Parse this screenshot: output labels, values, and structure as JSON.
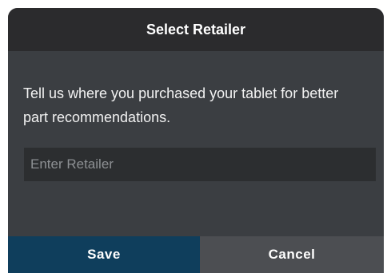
{
  "dialog": {
    "title": "Select Retailer",
    "message": "Tell us where you purchased your tablet for better part recommendations.",
    "retailer_input": {
      "value": "",
      "placeholder": "Enter Retailer"
    },
    "buttons": {
      "save_label": "Save",
      "cancel_label": "Cancel"
    }
  },
  "colors": {
    "dialog_background": "#3b3e42",
    "header_background": "#2b2b2d",
    "input_background": "#2c2e30",
    "save_button": "#0f3e5c",
    "cancel_button": "#4c4e52"
  }
}
